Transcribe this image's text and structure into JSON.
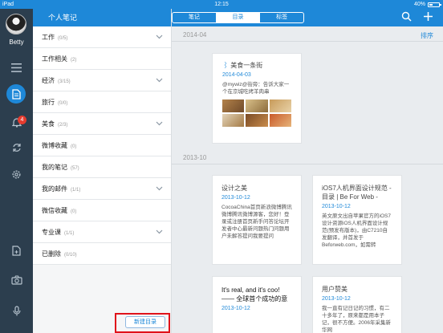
{
  "status": {
    "carrier": "iPad",
    "time": "12:15",
    "battery": "40%",
    "battery_level": 0.4
  },
  "user": {
    "name": "Betty"
  },
  "rail": {
    "badge": "4"
  },
  "category": {
    "title": "个人笔记",
    "items": [
      {
        "label": "工作",
        "count": "(0/5)"
      },
      {
        "label": "工作相关",
        "count": "(2)"
      },
      {
        "label": "经济",
        "count": "(3/15)"
      },
      {
        "label": "旅行",
        "count": "(0/0)"
      },
      {
        "label": "美食",
        "count": "(2/3)"
      },
      {
        "label": "微博收藏",
        "count": "(0)"
      },
      {
        "label": "我的笔记",
        "count": "(57)"
      },
      {
        "label": "我的邮件",
        "count": "(1/1)"
      },
      {
        "label": "微信收藏",
        "count": "(0)"
      },
      {
        "label": "专业课",
        "count": "(1/1)"
      },
      {
        "label": "已删除",
        "count": "(0/10)"
      }
    ],
    "new_button": "新建目录"
  },
  "main": {
    "tabs": [
      "笔记",
      "目录",
      "标签"
    ],
    "active_tab": "目录",
    "sort_label": "排序",
    "sections": [
      {
        "label": "2014-04"
      },
      {
        "label": "2013-10"
      }
    ],
    "cards": [
      {
        "title": "美食一条街",
        "date": "2014-04-03",
        "body": "@mywiz@街旁：告诉大家一个在京城吃烤羊肉串"
      },
      {
        "title": "设计之美",
        "date": "2013-10-12",
        "body": "CocoaChina首页新浪微博腾讯微博腾讯微博源客，您好！登录或注册首页新手问答论坛开发者中心最新问题热门问题用户未解答提问我要提问"
      },
      {
        "title": "iOS7人机界面设计规范 - 目录 | Be For Web -",
        "date": "2013-10-12",
        "body": "英文原文出自苹果官方的iOS7设计资源iOS人机界面设计规范(预发布版本)，由C7210自发翻译，并首发于Beforweb.com，如需转"
      },
      {
        "title": "It's real, and it's coo! —— 全球首个成功的意",
        "date": "2013-10-12",
        "body": ""
      },
      {
        "title": "用户赞美",
        "date": "2013-10-12",
        "body": "我一直有记日记的习惯，有二十多年了，原来都是用本子记，很不方便。2006年采集新华网"
      }
    ]
  },
  "colors": {
    "accent": "#1e88d8",
    "rail_bg": "#2c3e4e",
    "badge": "#e63b2e",
    "highlight": "#e0121a"
  }
}
